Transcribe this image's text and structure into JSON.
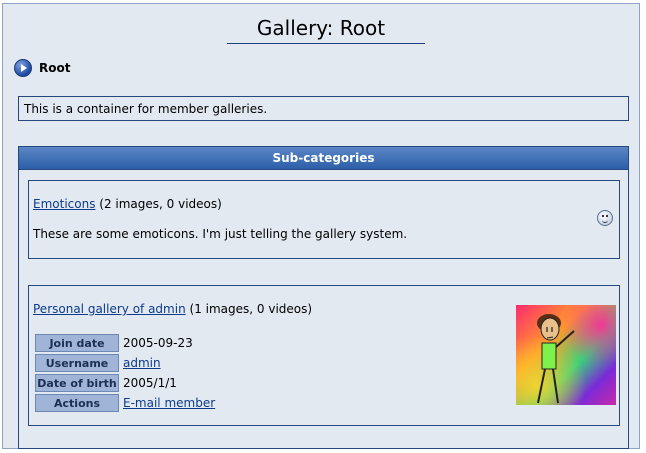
{
  "page": {
    "title": "Gallery: Root"
  },
  "breadcrumb": {
    "icon": "arrow-right-circle-icon",
    "label": "Root"
  },
  "description": "This is a container for member galleries.",
  "subcategories": {
    "header": "Sub-categories",
    "items": [
      {
        "name": "Emoticons",
        "counts": "(2 images, 0 videos)",
        "description": "These are some emoticons. I'm just telling the gallery system.",
        "icon": "smiley-icon"
      },
      {
        "name": "Personal gallery of admin",
        "counts": "(1 images, 0 videos)",
        "fields": [
          {
            "label": "Join date",
            "value": "2005-09-23"
          },
          {
            "label": "Username",
            "value": "admin"
          },
          {
            "label": "Date of birth",
            "value": "2005/1/1"
          },
          {
            "label": "Actions",
            "value": "E-mail member"
          }
        ],
        "avatar": "avatar-image"
      }
    ]
  }
}
